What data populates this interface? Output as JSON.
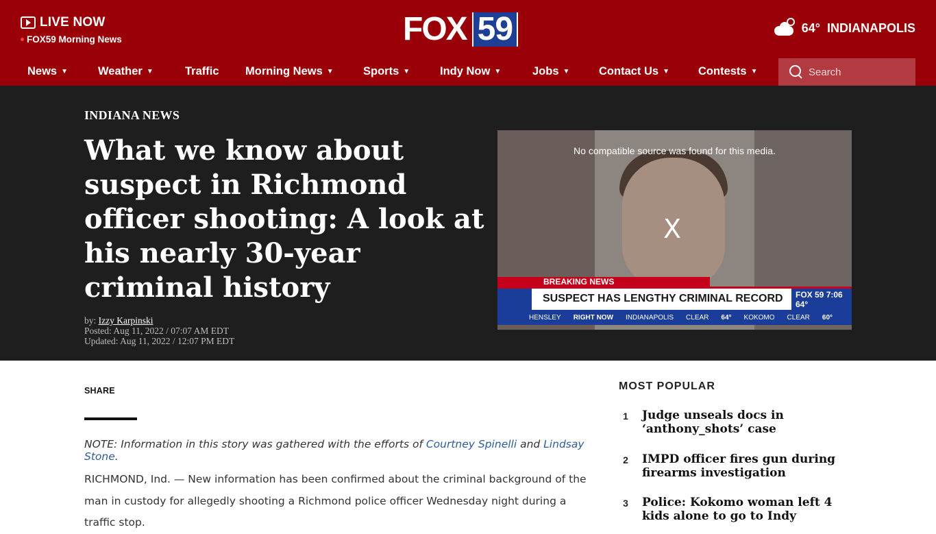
{
  "header": {
    "live_label": "LIVE NOW",
    "live_show": "FOX59 Morning News",
    "logo_fox": "FOX",
    "logo_num": "59",
    "weather_temp": "64°",
    "weather_city": "INDIANAPOLIS"
  },
  "nav": {
    "items": [
      {
        "label": "News",
        "dropdown": true
      },
      {
        "label": "Weather",
        "dropdown": true
      },
      {
        "label": "Traffic",
        "dropdown": false
      },
      {
        "label": "Morning News",
        "dropdown": true
      },
      {
        "label": "Sports",
        "dropdown": true
      },
      {
        "label": "Indy Now",
        "dropdown": true
      },
      {
        "label": "Jobs",
        "dropdown": true
      },
      {
        "label": "Contact Us",
        "dropdown": true
      },
      {
        "label": "Contests",
        "dropdown": true
      }
    ],
    "search_placeholder": "Search"
  },
  "article": {
    "category": "INDIANA NEWS",
    "headline": "What we know about suspect in Richmond officer shooting: A look at his nearly 30-year criminal history",
    "by_prefix": "by: ",
    "author": "Izzy Karpinski",
    "posted": "Posted: Aug 11, 2022 / 07:07 AM EDT",
    "updated": "Updated: Aug 11, 2022 / 12:07 PM EDT",
    "share_label": "SHARE",
    "note_prefix": "NOTE: Information in this story was gathered with the efforts of ",
    "note_link1": "Courtney Spinelli",
    "note_and": " and ",
    "note_link2": "Lindsay Stone",
    "note_suffix": ".",
    "body": "RICHMOND, Ind. — New information has been confirmed about the criminal background of the man in custody for allegedly shooting a Richmond police officer Wednesday night during a traffic stop."
  },
  "video": {
    "error_message": "No compatible source was found for this media.",
    "close_glyph": "X",
    "breaking": "BREAKING NEWS",
    "lower_third": "SUSPECT HAS LENGTHY CRIMINAL RECORD",
    "bug_logo": "FOX 59",
    "bug_time": "7:06",
    "bug_temp": "64°",
    "ticker_sponsor": "HENSLEY",
    "ticker_label": "RIGHT NOW",
    "ticker_city1": "INDIANAPOLIS",
    "ticker_cond1": "CLEAR",
    "ticker_temp1": "64°",
    "ticker_city2": "KOKOMO",
    "ticker_cond2": "CLEAR",
    "ticker_temp2": "60°"
  },
  "popular": {
    "title": "MOST POPULAR",
    "items": [
      {
        "num": "1",
        "title": "Judge unseals docs in ‘anthony_shots’ case"
      },
      {
        "num": "2",
        "title": "IMPD officer fires gun during firearms investigation"
      },
      {
        "num": "3",
        "title": "Police: Kokomo woman left 4 kids alone to go to Indy"
      }
    ]
  },
  "colors": {
    "header_red": "#9a0007",
    "hero_dark": "#1e1e1e",
    "link_blue": "#2e5c9a",
    "logo_blue": "#1d3f95"
  }
}
